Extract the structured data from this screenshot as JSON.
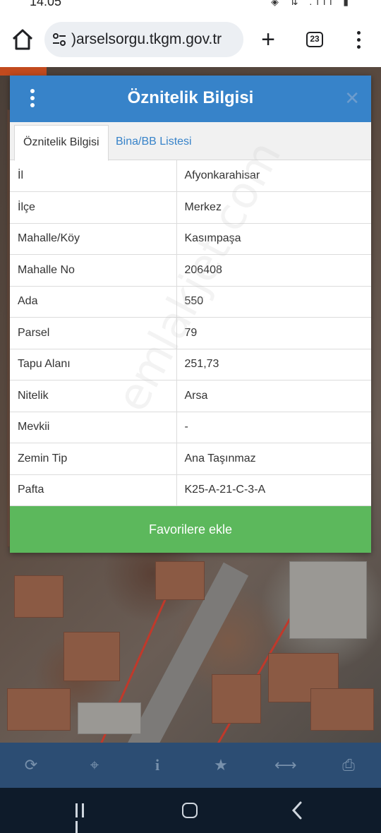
{
  "status": {
    "time": "14:05",
    "icons_text": "◈ ⇅ .ıll ▮"
  },
  "browser": {
    "url": ")arselsorgu.tkgm.gov.tr",
    "plus": "+",
    "tab_count": "23"
  },
  "dialog": {
    "title": "Öznitelik Bilgisi",
    "close": "✕",
    "tabs": [
      {
        "label": "Öznitelik Bilgisi",
        "active": true
      },
      {
        "label": "Bina/BB Listesi",
        "active": false
      }
    ],
    "rows": [
      {
        "key": "İl",
        "value": "Afyonkarahisar"
      },
      {
        "key": "İlçe",
        "value": "Merkez"
      },
      {
        "key": "Mahalle/Köy",
        "value": "Kasımpaşa"
      },
      {
        "key": "Mahalle No",
        "value": "206408"
      },
      {
        "key": "Ada",
        "value": "550"
      },
      {
        "key": "Parsel",
        "value": "79"
      },
      {
        "key": "Tapu Alanı",
        "value": "251,73"
      },
      {
        "key": "Nitelik",
        "value": "Arsa"
      },
      {
        "key": "Mevkii",
        "value": "-"
      },
      {
        "key": "Zemin Tip",
        "value": "Ana Taşınmaz"
      },
      {
        "key": "Pafta",
        "value": "K25-A-21-C-3-A"
      }
    ],
    "favorite_button": "Favorilere ekle"
  },
  "watermark": "emlakjet.com",
  "toolbar": {
    "icons": [
      "refresh-icon",
      "crosshair-icon",
      "info-icon",
      "star-icon",
      "measure-icon",
      "print-icon"
    ]
  },
  "colors": {
    "header_blue": "#3783c9",
    "favorite_green": "#5cb85c",
    "toolbar_blue": "#2c4d73",
    "navbar_dark": "#0e1b2a"
  }
}
